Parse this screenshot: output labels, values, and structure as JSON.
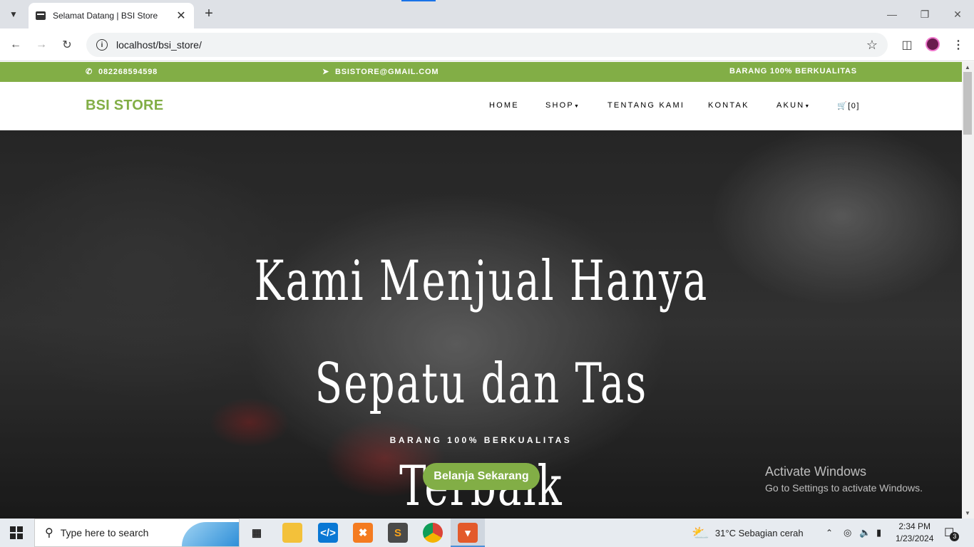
{
  "browser": {
    "tab_title": "Selamat Datang | BSI Store",
    "url": "localhost/bsi_store/"
  },
  "topbar": {
    "phone": "082268594598",
    "email": "BSISTORE@GMAIL.COM",
    "tagline": "BARANG 100% BERKUALITAS"
  },
  "nav": {
    "brand": "BSI STORE",
    "items": [
      "HOME",
      "SHOP",
      "TENTANG KAMI",
      "KONTAK",
      "AKUN"
    ],
    "cart": "[0]"
  },
  "hero": {
    "heading_line1": "Kami Menjual Hanya Sepatu dan Tas",
    "heading_line2": "Terbaik",
    "subheading": "BARANG 100% BERKUALITAS",
    "cta": "Belanja Sekarang"
  },
  "watermark": {
    "title": "Activate Windows",
    "subtitle": "Go to Settings to activate Windows."
  },
  "taskbar": {
    "search_placeholder": "Type here to search",
    "weather": "31°C  Sebagian cerah",
    "time": "2:34 PM",
    "date": "1/23/2024",
    "notifications": "3"
  },
  "colors": {
    "accent": "#82ae46"
  }
}
